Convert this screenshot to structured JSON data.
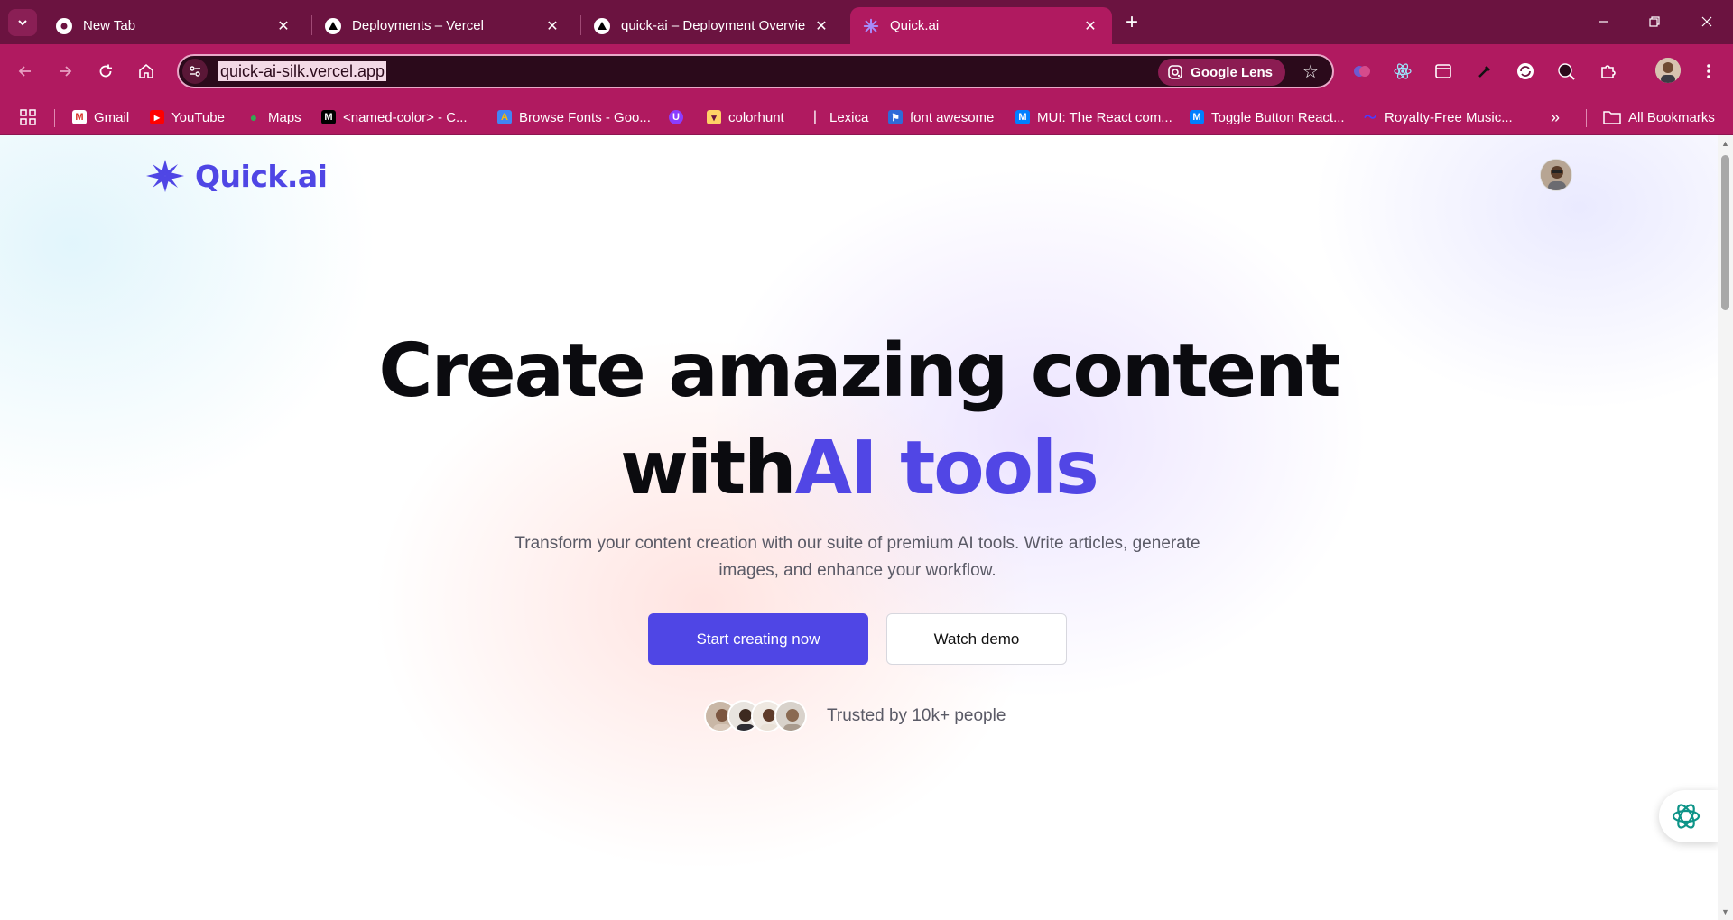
{
  "browser": {
    "tabs": [
      {
        "title": "New Tab",
        "favicon": "chrome-icon"
      },
      {
        "title": "Deployments – Vercel",
        "favicon": "vercel-icon"
      },
      {
        "title": "quick-ai – Deployment Overview",
        "favicon": "vercel-icon"
      },
      {
        "title": "Quick.ai",
        "favicon": "quickai-icon",
        "active": true
      }
    ],
    "url": "quick-ai-silk.vercel.app",
    "lens_label": "Google Lens",
    "bookmarks": [
      {
        "label": "Gmail",
        "icon": "gmail-icon"
      },
      {
        "label": "YouTube",
        "icon": "youtube-icon"
      },
      {
        "label": "Maps",
        "icon": "maps-icon"
      },
      {
        "label": "<named-color> - C...",
        "icon": "mdn-icon"
      },
      {
        "label": "Browse Fonts - Goo...",
        "icon": "google-fonts-icon"
      },
      {
        "label": "",
        "icon": "purple-circle-icon"
      },
      {
        "label": "colorhunt",
        "icon": "colorhunt-icon"
      },
      {
        "label": "Lexica",
        "icon": "lexica-icon"
      },
      {
        "label": "font awesome",
        "icon": "fontawesome-icon"
      },
      {
        "label": "MUI: The React com...",
        "icon": "mui-icon"
      },
      {
        "label": "Toggle Button React...",
        "icon": "mui-icon"
      },
      {
        "label": "Royalty-Free Music...",
        "icon": "pixabay-icon"
      }
    ],
    "all_bookmarks_label": "All Bookmarks",
    "colors": {
      "frame": "#6b1340",
      "toolbar": "#b01a60"
    }
  },
  "page": {
    "logo_text": "Quick.ai",
    "hero": {
      "title_line1": "Create amazing content",
      "title_line2_prefix": "with",
      "title_line2_accent": "AI tools",
      "subtitle": "Transform your content creation with our suite of premium AI tools. Write articles, generate images, and enhance your workflow."
    },
    "primary_button": "Start creating now",
    "secondary_button": "Watch demo",
    "trusted_text": "Trusted by 10k+ people",
    "colors": {
      "accent": "#4f46e5"
    }
  }
}
